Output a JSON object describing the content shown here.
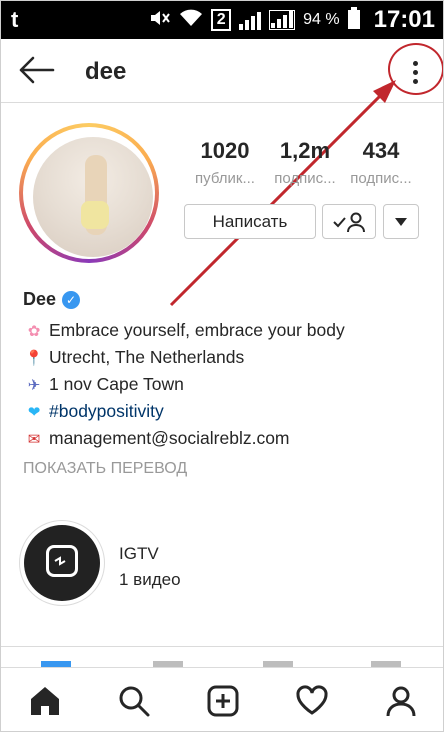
{
  "status_bar": {
    "app_icon": "t",
    "network_badge": "2",
    "battery": "94 %",
    "time": "17:01"
  },
  "header": {
    "title": "dee"
  },
  "profile": {
    "stats": [
      {
        "value": "1020",
        "label": "публик..."
      },
      {
        "value": "1,2m",
        "label": "подпис..."
      },
      {
        "value": "434",
        "label": "подпис..."
      }
    ],
    "message_button": "Написать",
    "name": "Dee",
    "bio": [
      {
        "icon": "flower-icon",
        "text": "Embrace yourself, embrace your body"
      },
      {
        "icon": "pin-icon",
        "text": "Utrecht, The Netherlands"
      },
      {
        "icon": "plane-icon",
        "text": "1 nov Cape Town"
      },
      {
        "icon": "heart-icon",
        "text": "#bodypositivity"
      },
      {
        "icon": "mailbox-icon",
        "text": "management@socialreblz.com"
      }
    ],
    "translate": "ПОКАЗАТЬ ПЕРЕВОД"
  },
  "highlight": {
    "title": "IGTV",
    "subtitle": "1 видео"
  },
  "colors": {
    "annotation": "#c1272d",
    "link": "#003569",
    "verified": "#3897f0"
  }
}
